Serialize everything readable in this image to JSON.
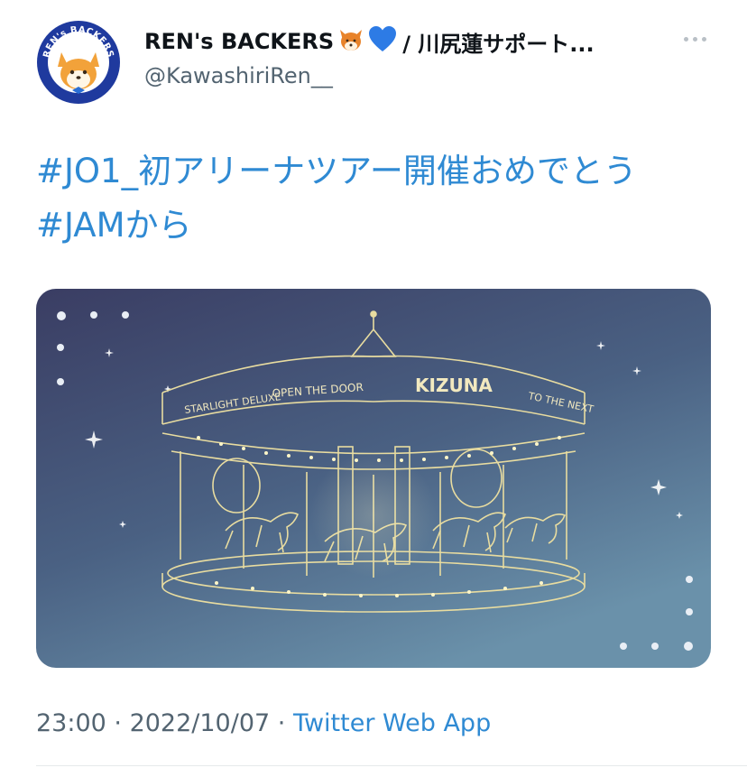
{
  "author": {
    "display_name": "REN's BACKERS",
    "emoji_1": "fox-face",
    "emoji_2": "blue-heart",
    "name_suffix": "/ 川尻蓮サポート...",
    "handle": "@KawashiriRen__",
    "avatar_text": "REN's BACKERS"
  },
  "tweet": {
    "lines": [
      "#JO1_初アリーナツアー開催おめでとう",
      "#JAMから"
    ]
  },
  "media": {
    "signs": [
      "STARLIGHT DELUXE",
      "OPEN THE DOOR",
      "KIZUNA",
      "TO THE NEXT"
    ]
  },
  "meta": {
    "time": "23:00",
    "separator_1": " · ",
    "date": "2022/10/07",
    "separator_2": " · ",
    "app": "Twitter Web App"
  },
  "colors": {
    "link": "#2f8ad3",
    "muted": "#536471",
    "avatar_blue": "#1f3a9e"
  }
}
